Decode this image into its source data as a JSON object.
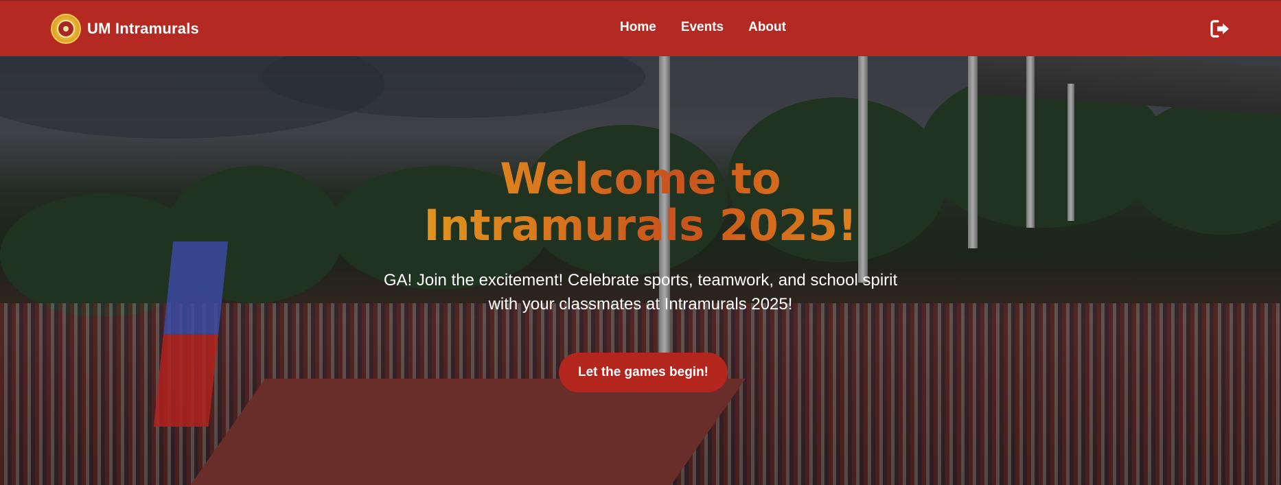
{
  "navbar": {
    "brand_name": "UM Intramurals",
    "logo_icon": "university-seal-icon",
    "links": [
      {
        "label": "Home"
      },
      {
        "label": "Events"
      },
      {
        "label": "About"
      }
    ],
    "logout_icon": "sign-out-icon"
  },
  "hero": {
    "title_line1": "Welcome to",
    "title_line2": "Intramurals 2025!",
    "subtitle_line1": "GA! Join the excitement! Celebrate sports, teamwork, and school spirit",
    "subtitle_line2": "with your classmates at Intramurals 2025!",
    "cta_label": "Let the games begin!"
  },
  "colors": {
    "navbar_bg": "#b42a22",
    "cta_bg": "#b3261e",
    "title_gradient": [
      "#e8b21e",
      "#c8521d",
      "#f0a31a"
    ]
  }
}
